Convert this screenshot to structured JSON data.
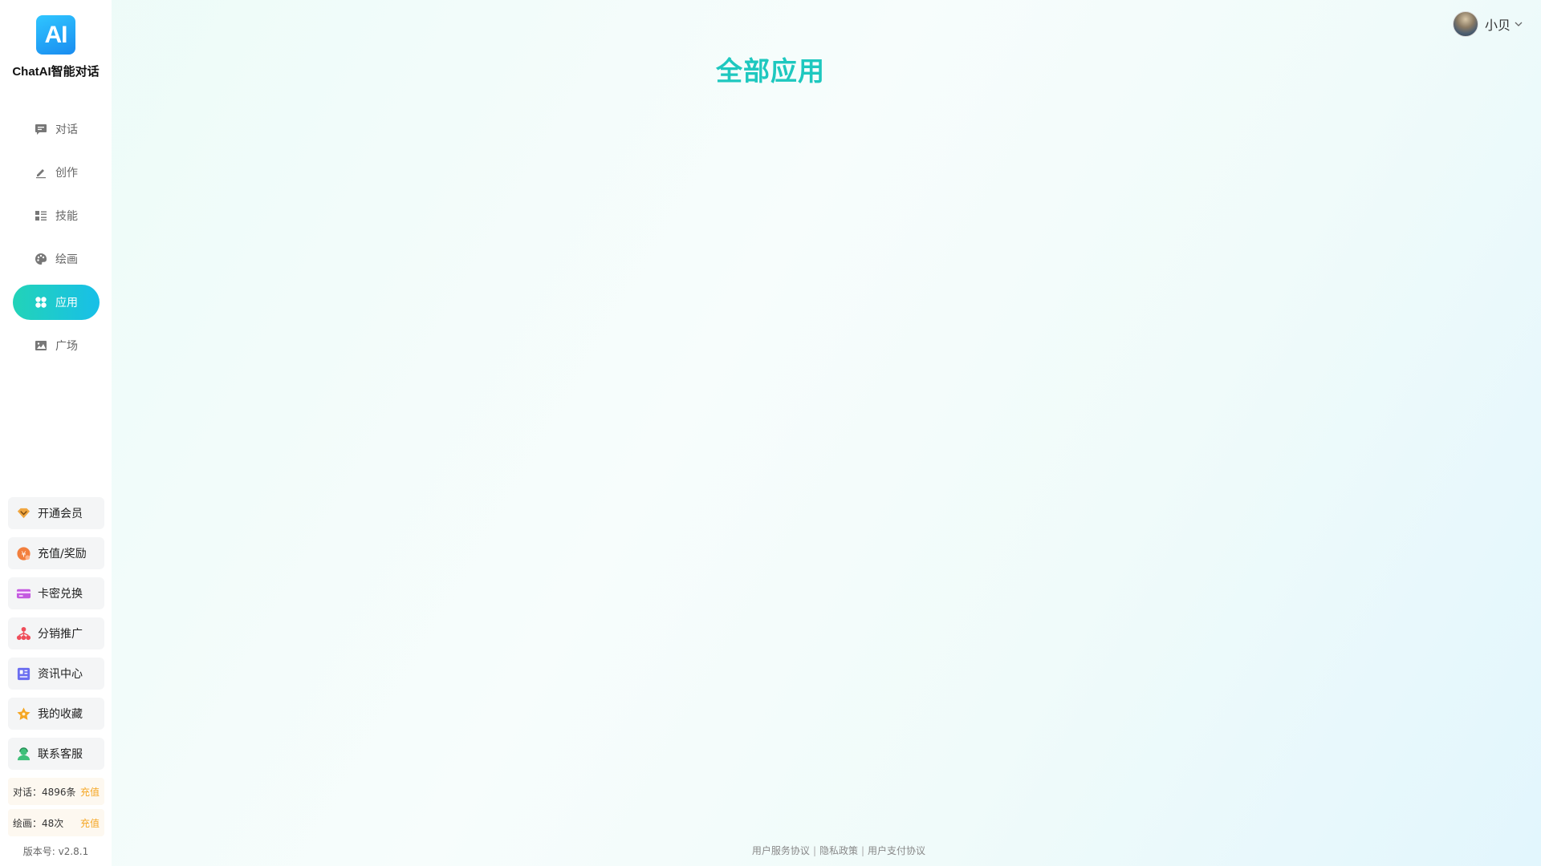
{
  "brand": {
    "logo_text": "AI",
    "name": "ChatAI智能对话"
  },
  "nav": {
    "items": [
      {
        "label": "对话",
        "icon": "chat-icon"
      },
      {
        "label": "创作",
        "icon": "pen-icon"
      },
      {
        "label": "技能",
        "icon": "list-icon"
      },
      {
        "label": "绘画",
        "icon": "palette-icon"
      },
      {
        "label": "应用",
        "icon": "apps-icon",
        "active": true
      },
      {
        "label": "广场",
        "icon": "image-icon"
      }
    ]
  },
  "menu": {
    "items": [
      {
        "label": "开通会员",
        "icon": "vip-diamond-icon"
      },
      {
        "label": "充值/奖励",
        "icon": "recharge-coin-icon"
      },
      {
        "label": "卡密兑换",
        "icon": "card-icon"
      },
      {
        "label": "分销推广",
        "icon": "distribution-icon"
      },
      {
        "label": "资讯中心",
        "icon": "news-icon"
      },
      {
        "label": "我的收藏",
        "icon": "star-icon"
      },
      {
        "label": "联系客服",
        "icon": "customer-service-icon"
      }
    ]
  },
  "quota": {
    "chat": {
      "text": "对话：4896条",
      "action": "充值"
    },
    "draw": {
      "text": "绘画：48次",
      "action": "充值"
    }
  },
  "version": "版本号: v2.8.1",
  "page": {
    "title": "全部应用"
  },
  "user": {
    "name": "小贝"
  },
  "footer": {
    "links": [
      "用户服务协议",
      "隐私政策",
      "用户支付协议"
    ],
    "separator": "|"
  },
  "colors": {
    "accent": "#1ec8bf",
    "active_gradient_start": "#22d3b8",
    "active_gradient_end": "#18bfe8",
    "recharge": "#f5a623"
  }
}
